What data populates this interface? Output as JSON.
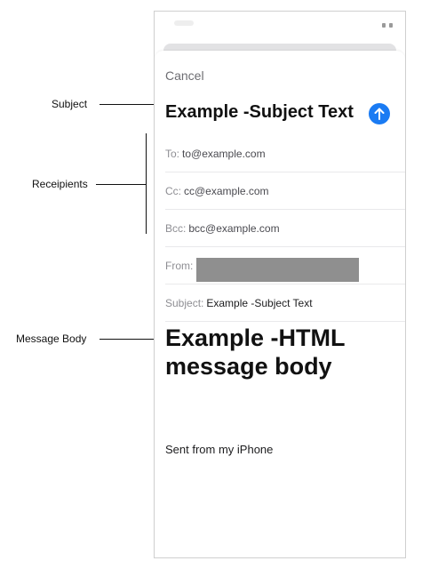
{
  "annotations": {
    "subject": "Subject",
    "recipients": "Receipients",
    "message_body": "Message Body"
  },
  "compose": {
    "cancel_label": "Cancel",
    "subject_heading": "Example -Subject Text",
    "send_icon": "arrow-up-icon",
    "to_label": "To:",
    "to_value": "to@example.com",
    "cc_label": "Cc:",
    "cc_value": "cc@example.com",
    "bcc_label": "Bcc:",
    "bcc_value": "bcc@example.com",
    "from_label": "From:",
    "subject_label": "Subject:",
    "subject_value": "Example -Subject Text",
    "body_text": "Example -HTML message body",
    "signature": "Sent from my iPhone"
  },
  "colors": {
    "accent": "#1a7bf3",
    "redaction": "#8f8f8f"
  }
}
